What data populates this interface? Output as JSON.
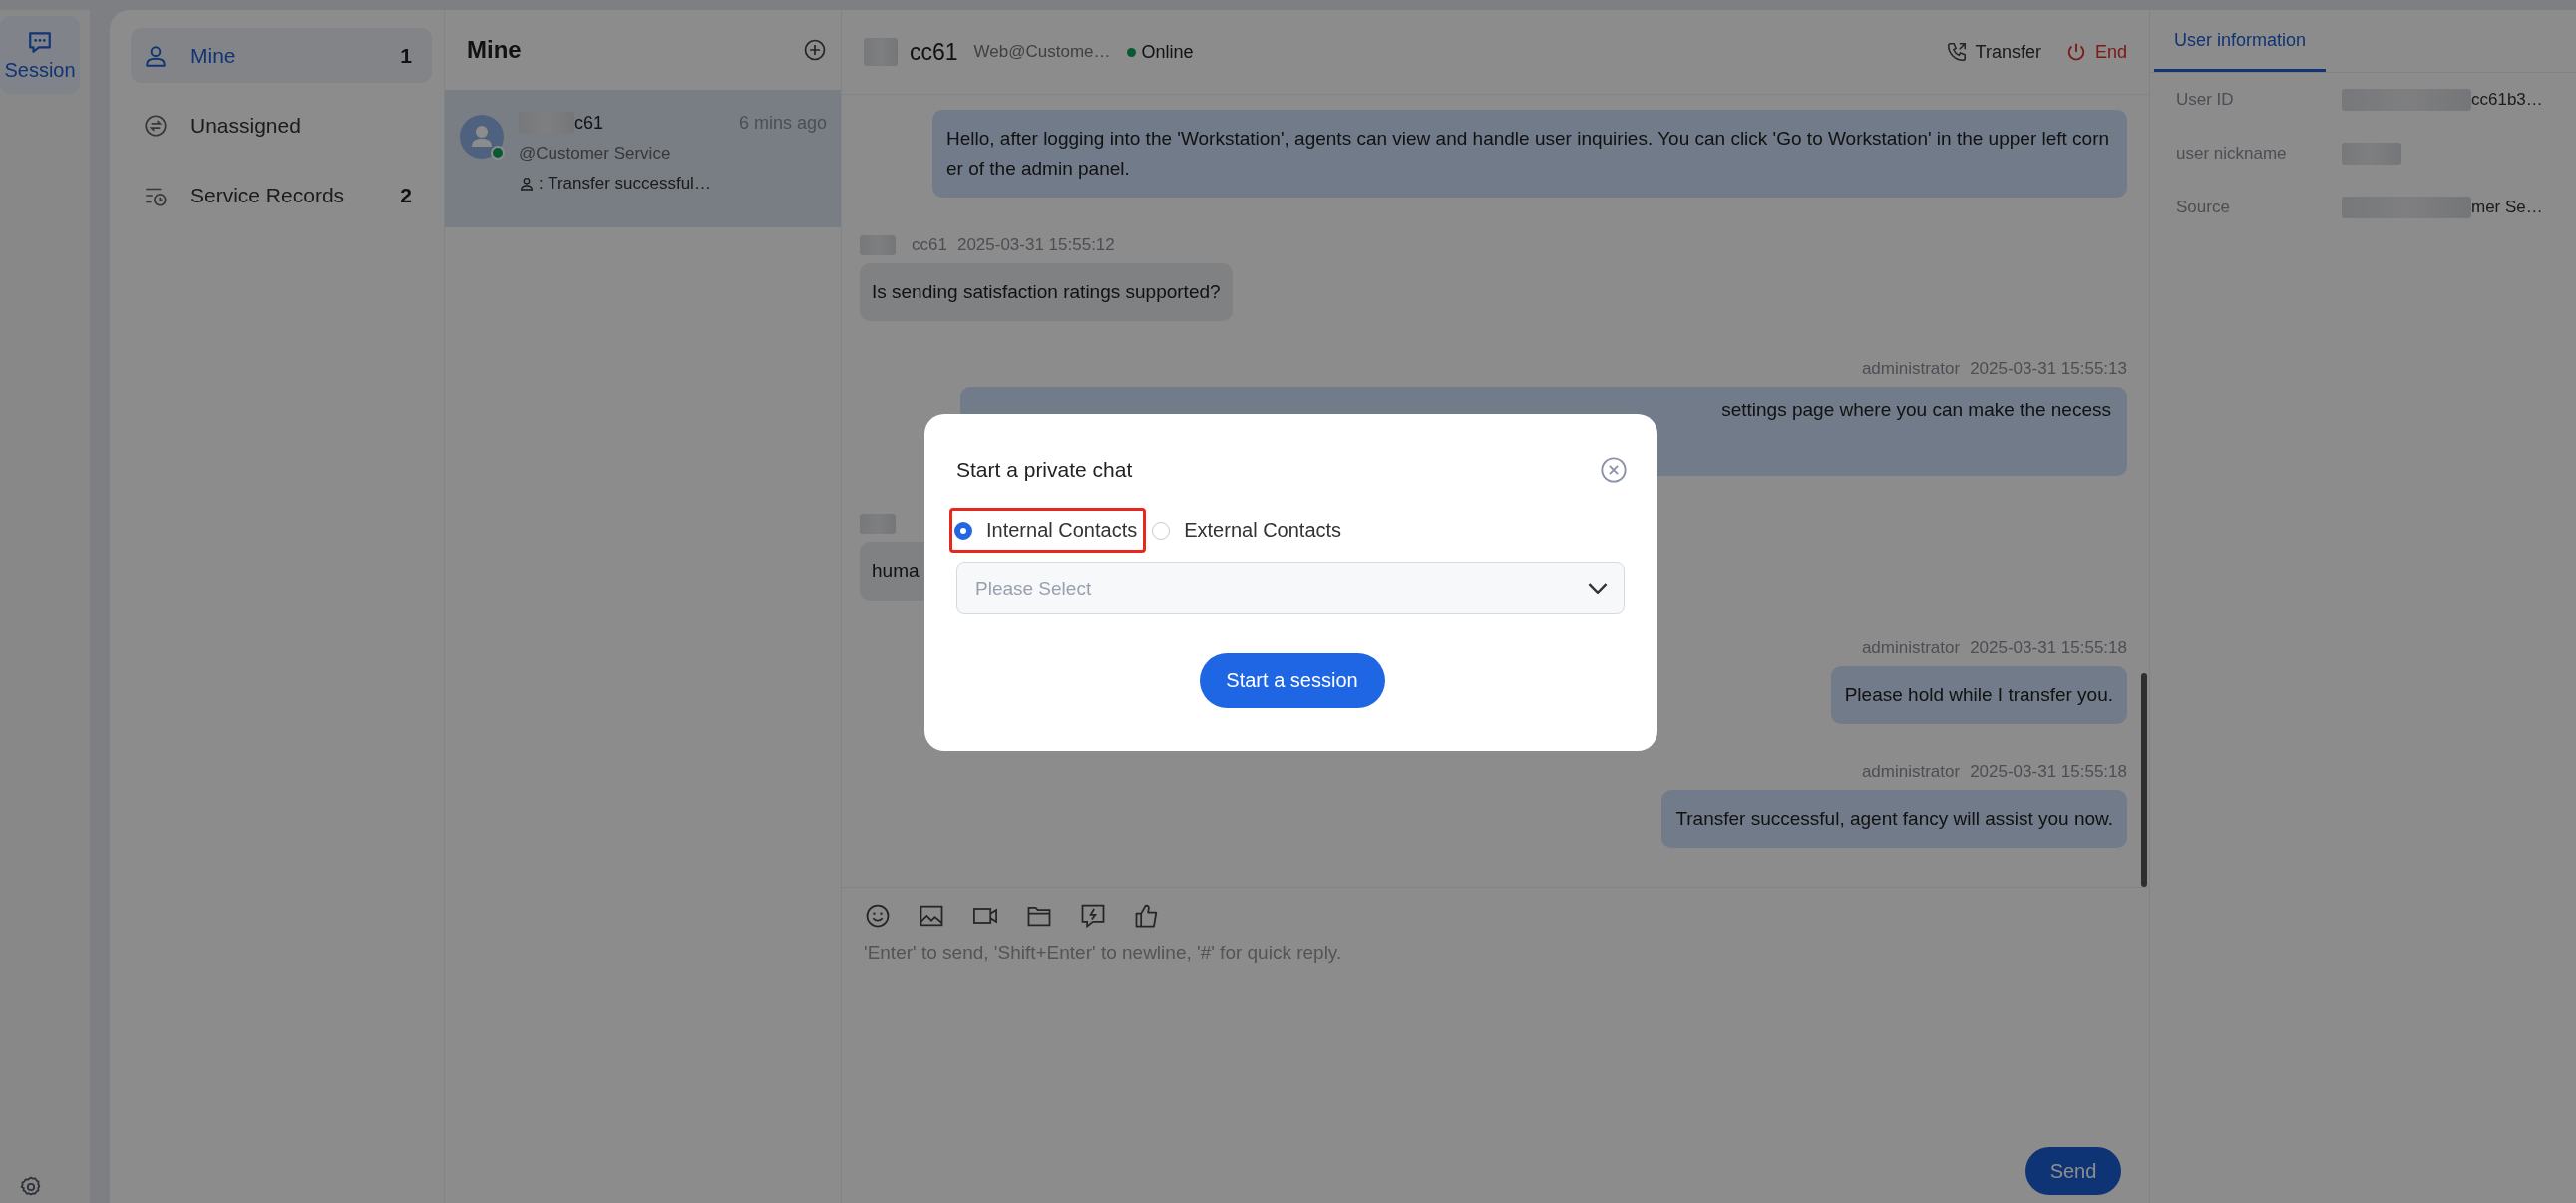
{
  "nav_rail": {
    "items": [
      {
        "label": "Session",
        "selected": true
      }
    ]
  },
  "categories": [
    {
      "label": "Mine",
      "count": "1",
      "selected": true,
      "kind": "mine"
    },
    {
      "label": "Unassigned",
      "selected": false,
      "kind": "unassigned"
    },
    {
      "label": "Service Records",
      "count": "2",
      "selected": false,
      "kind": "records"
    }
  ],
  "session_list": {
    "title": "Mine",
    "sessions": [
      {
        "name": "c61",
        "time": "6 mins ago",
        "channel": "@Customer Service",
        "preview": ": Transfer successful…",
        "online": true,
        "selected": true
      }
    ]
  },
  "chat": {
    "header": {
      "name": "cc61",
      "source": "Web@Custome…",
      "status": "Online",
      "online": true,
      "actions": [
        {
          "label": "Transfer",
          "kind": "transfer"
        },
        {
          "label": "End",
          "kind": "end"
        }
      ]
    },
    "messages": [
      {
        "kind": "outgoing",
        "text": "Hello, after logging into the 'Workstation', agents can view and handle user inquiries. You can click 'Go to Workstation' in the upper left corner of the admin panel."
      },
      {
        "kind": "incoming",
        "sender": "cc61",
        "time": "2025-03-31 15:55:12",
        "text": "Is sending satisfaction ratings supported?"
      },
      {
        "kind": "outgoing",
        "sender": "administrator",
        "time": "2025-03-31 15:55:13",
        "text": "settings page where you can make the necess",
        "covered": true
      },
      {
        "kind": "incoming",
        "text": "huma",
        "covered": true
      },
      {
        "kind": "outgoing",
        "sender": "administrator",
        "time": "2025-03-31 15:55:18",
        "text": "Please hold while I transfer you."
      },
      {
        "kind": "outgoing",
        "sender": "administrator",
        "time": "2025-03-31 15:55:18",
        "text": "Transfer successful, agent fancy will assist you now."
      }
    ],
    "composer": {
      "placeholder": "'Enter' to send, 'Shift+Enter' to newline, '#' for quick reply.",
      "send": "Send"
    }
  },
  "user_info": {
    "tab": "User information",
    "fields": [
      {
        "label": "User ID",
        "value": "cc61b3…"
      },
      {
        "label": "user nickname"
      },
      {
        "label": "Source",
        "value": "mer Se…"
      }
    ]
  },
  "modal": {
    "title": "Start a private chat",
    "options": [
      {
        "label": "Internal Contacts",
        "selected": true,
        "highlighted": true
      },
      {
        "label": "External Contacts",
        "selected": false
      }
    ],
    "select_placeholder": "Please Select",
    "button": "Start a session"
  }
}
